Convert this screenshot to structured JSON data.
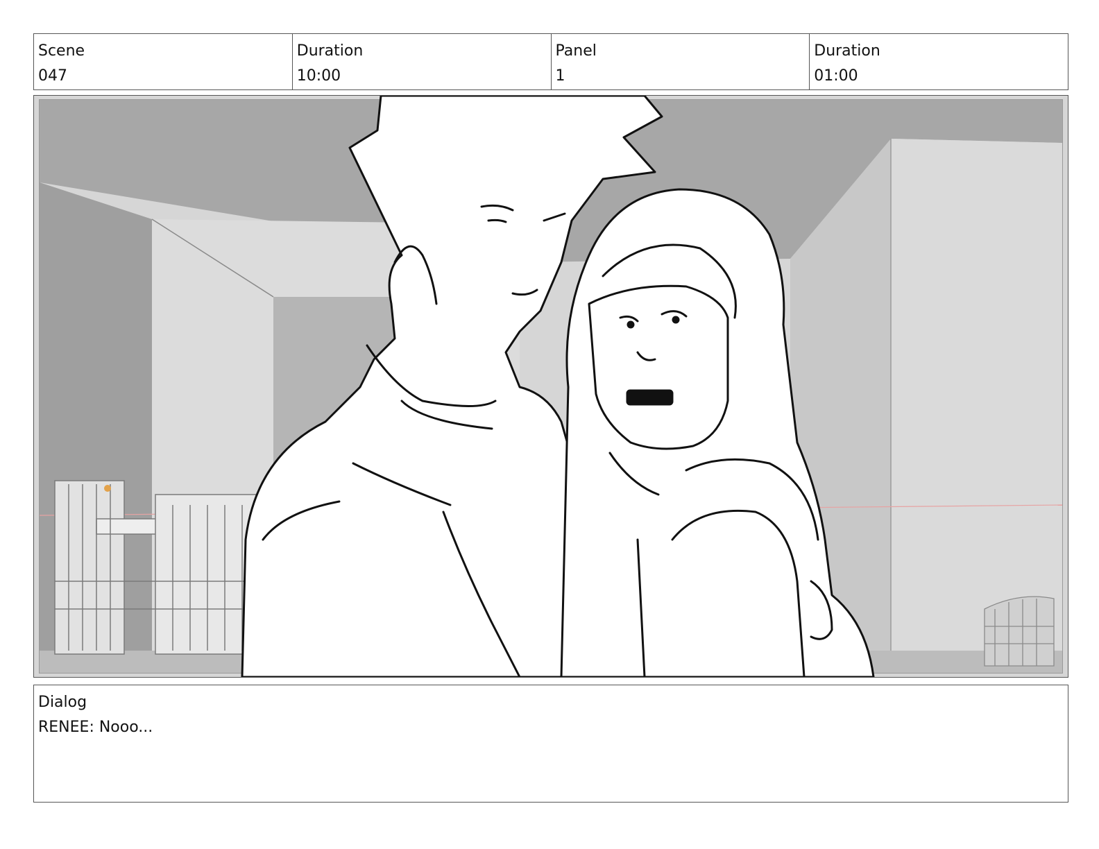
{
  "header": {
    "scene_label": "Scene",
    "scene_value": "047",
    "scene_duration_label": "Duration",
    "scene_duration_value": "10:00",
    "panel_label": "Panel",
    "panel_value": "1",
    "panel_duration_label": "Duration",
    "panel_duration_value": "01:00"
  },
  "dialog": {
    "label": "Dialog",
    "text": "RENEE: Nooo..."
  }
}
